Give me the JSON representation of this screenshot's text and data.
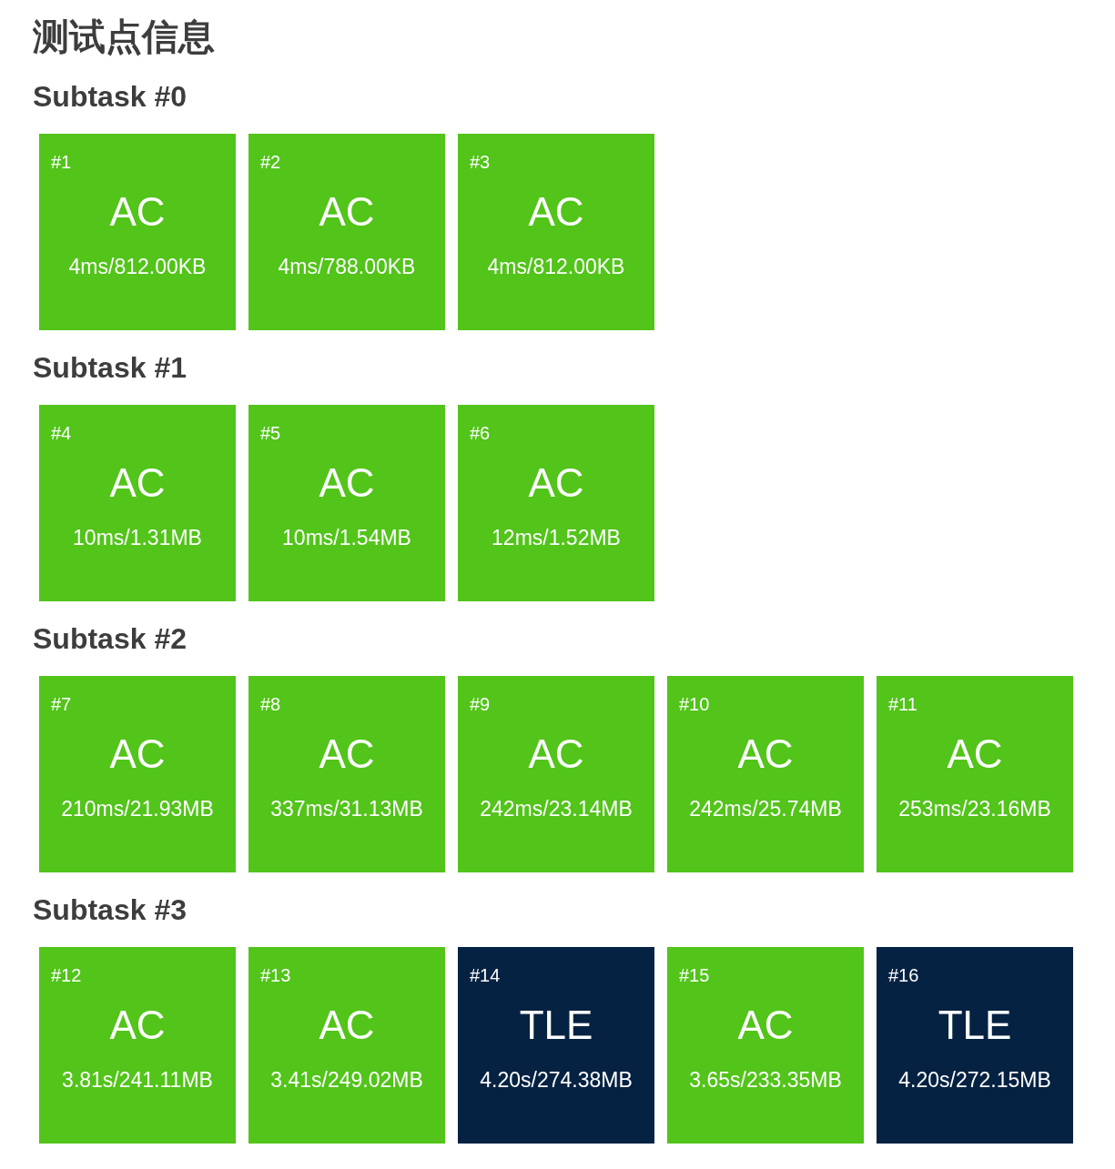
{
  "title": "测试点信息",
  "subtasks": [
    {
      "name": "Subtask #0",
      "cases": [
        {
          "id": "#1",
          "status": "AC",
          "stats": "4ms/812.00KB",
          "color": "#52c41a"
        },
        {
          "id": "#2",
          "status": "AC",
          "stats": "4ms/788.00KB",
          "color": "#52c41a"
        },
        {
          "id": "#3",
          "status": "AC",
          "stats": "4ms/812.00KB",
          "color": "#52c41a"
        }
      ]
    },
    {
      "name": "Subtask #1",
      "cases": [
        {
          "id": "#4",
          "status": "AC",
          "stats": "10ms/1.31MB",
          "color": "#52c41a"
        },
        {
          "id": "#5",
          "status": "AC",
          "stats": "10ms/1.54MB",
          "color": "#52c41a"
        },
        {
          "id": "#6",
          "status": "AC",
          "stats": "12ms/1.52MB",
          "color": "#52c41a"
        }
      ]
    },
    {
      "name": "Subtask #2",
      "cases": [
        {
          "id": "#7",
          "status": "AC",
          "stats": "210ms/21.93MB",
          "color": "#52c41a"
        },
        {
          "id": "#8",
          "status": "AC",
          "stats": "337ms/31.13MB",
          "color": "#52c41a"
        },
        {
          "id": "#9",
          "status": "AC",
          "stats": "242ms/23.14MB",
          "color": "#52c41a"
        },
        {
          "id": "#10",
          "status": "AC",
          "stats": "242ms/25.74MB",
          "color": "#52c41a"
        },
        {
          "id": "#11",
          "status": "AC",
          "stats": "253ms/23.16MB",
          "color": "#52c41a"
        }
      ]
    },
    {
      "name": "Subtask #3",
      "cases": [
        {
          "id": "#12",
          "status": "AC",
          "stats": "3.81s/241.11MB",
          "color": "#52c41a"
        },
        {
          "id": "#13",
          "status": "AC",
          "stats": "3.41s/249.02MB",
          "color": "#52c41a"
        },
        {
          "id": "#14",
          "status": "TLE",
          "stats": "4.20s/274.38MB",
          "color": "#052242"
        },
        {
          "id": "#15",
          "status": "AC",
          "stats": "3.65s/233.35MB",
          "color": "#52c41a"
        },
        {
          "id": "#16",
          "status": "TLE",
          "stats": "4.20s/272.15MB",
          "color": "#052242"
        }
      ]
    }
  ]
}
